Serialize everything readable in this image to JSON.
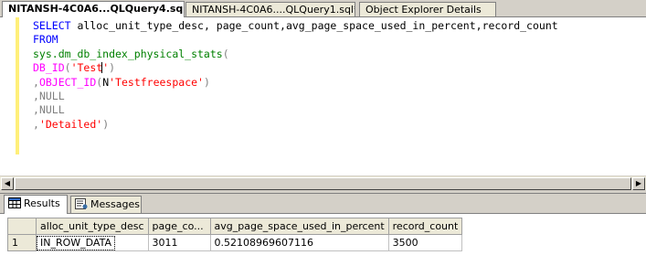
{
  "tabs": [
    {
      "label": "NITANSH-4C0A6...QLQuery4.sql*",
      "active": true
    },
    {
      "label": "NITANSH-4C0A6....QLQuery1.sql*",
      "active": false
    },
    {
      "label": "Object Explorer Details",
      "active": false
    }
  ],
  "editor": {
    "line1_kw": "SELECT",
    "line1_rest": " alloc_unit_type_desc, page_count,avg_page_space_used_in_percent,record_count",
    "line2_kw": "FROM",
    "line3_sys": "sys.dm_db_index_physical_stats",
    "line3_paren": "(",
    "line4_fn": "DB_ID",
    "line4_open": "(",
    "line4_str_a": "'Test",
    "line4_str_b": "'",
    "line4_close": ")",
    "line5_comma": ",",
    "line5_fn": "OBJECT_ID",
    "line5_open": "(",
    "line5_n": "N",
    "line5_str": "'Testfreespace'",
    "line5_close": ")",
    "line6_comma": ",",
    "line6_kw": "NULL",
    "line7_comma": ",",
    "line7_kw": "NULL",
    "line8_comma": ",",
    "line8_str": "'Detailed'",
    "line8_close": ")"
  },
  "results_tabs": {
    "results_label": "Results",
    "messages_label": "Messages"
  },
  "grid": {
    "columns": [
      "alloc_unit_type_desc",
      "page_co...",
      "avg_page_space_used_in_percent",
      "record_count"
    ],
    "rows": [
      {
        "num": "1",
        "cells": [
          "IN_ROW_DATA",
          "3011",
          "0.52108969607116",
          "3500"
        ]
      }
    ]
  }
}
